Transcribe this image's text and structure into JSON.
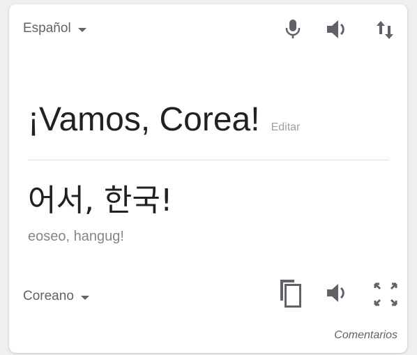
{
  "source": {
    "language": "Español",
    "text": "¡Vamos, Corea!",
    "edit_label": "Editar"
  },
  "target": {
    "language": "Coreano",
    "text": "어서, 한국!",
    "romanization": "eoseo, hangug!"
  },
  "feedback_label": "Comentarios",
  "icons": {
    "mic": "microphone-icon",
    "speaker": "speaker-icon",
    "swap": "swap-languages-icon",
    "copy": "copy-icon",
    "fullscreen": "fullscreen-icon"
  },
  "colors": {
    "icon": "#5f6368",
    "text_primary": "#202124",
    "text_secondary": "#80868b",
    "edit": "#9aa0a6"
  }
}
